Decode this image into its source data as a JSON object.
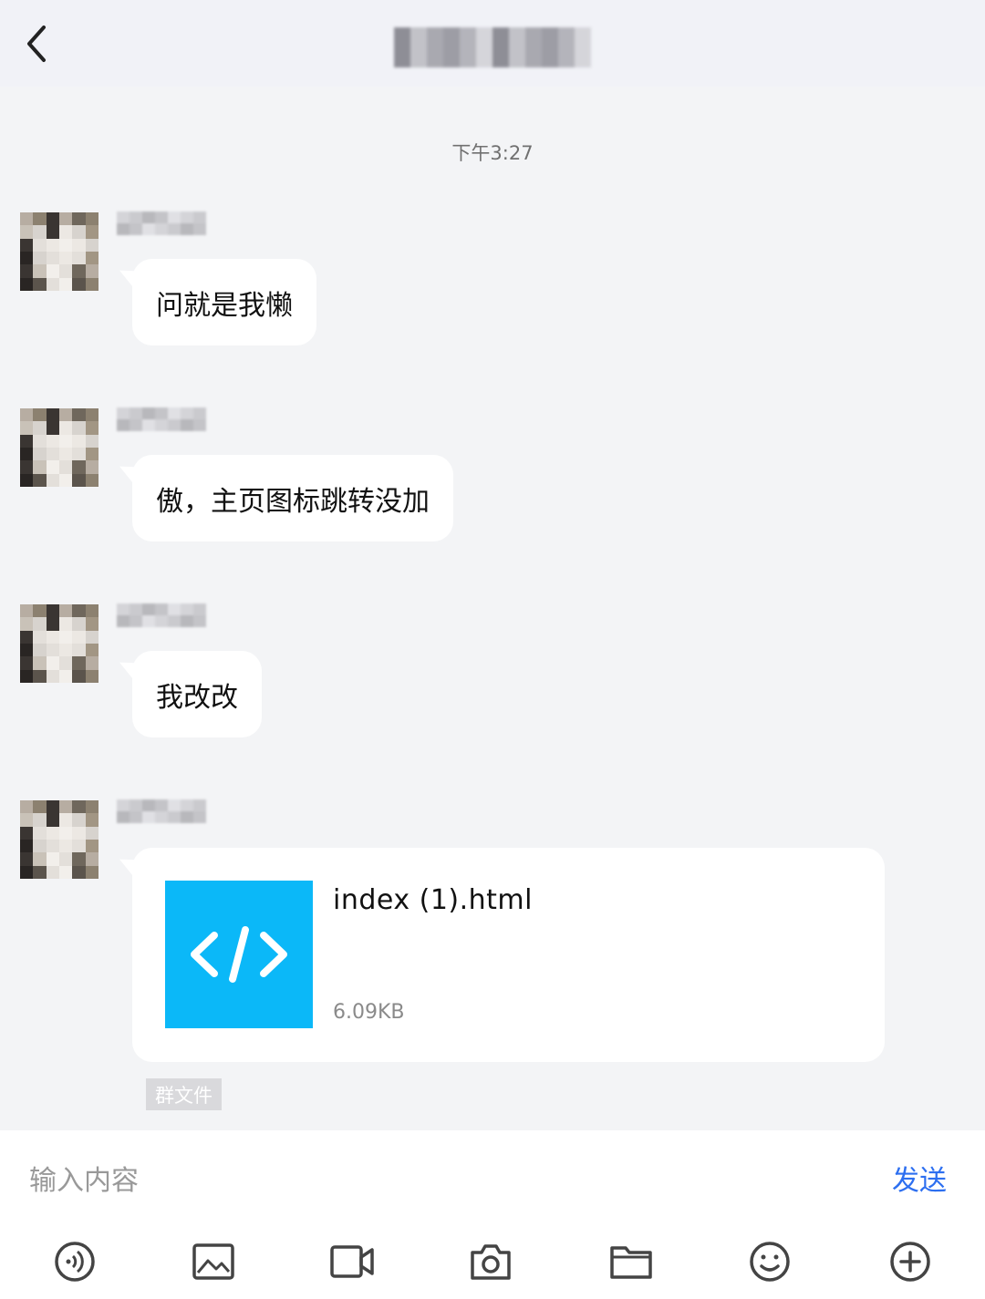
{
  "header": {
    "back_icon": "chevron-left-icon"
  },
  "timestamp": "下午3:27",
  "messages": [
    {
      "text": "问就是我懒"
    },
    {
      "text": "傲，主页图标跳转没加"
    },
    {
      "text": "我改改"
    }
  ],
  "file": {
    "name": "index (1).html",
    "size": "6.09KB",
    "source": "群文件",
    "icon": "code-file-icon"
  },
  "input": {
    "placeholder": "输入内容",
    "send_label": "发送"
  },
  "toolbar": {
    "items": [
      "voice-icon",
      "image-icon",
      "video-icon",
      "camera-icon",
      "folder-icon",
      "emoji-icon",
      "plus-circle-icon"
    ]
  },
  "colors": {
    "accent": "#2d6ff0",
    "file_icon_bg": "#0bb8f8",
    "background": "#f3f4f6"
  }
}
